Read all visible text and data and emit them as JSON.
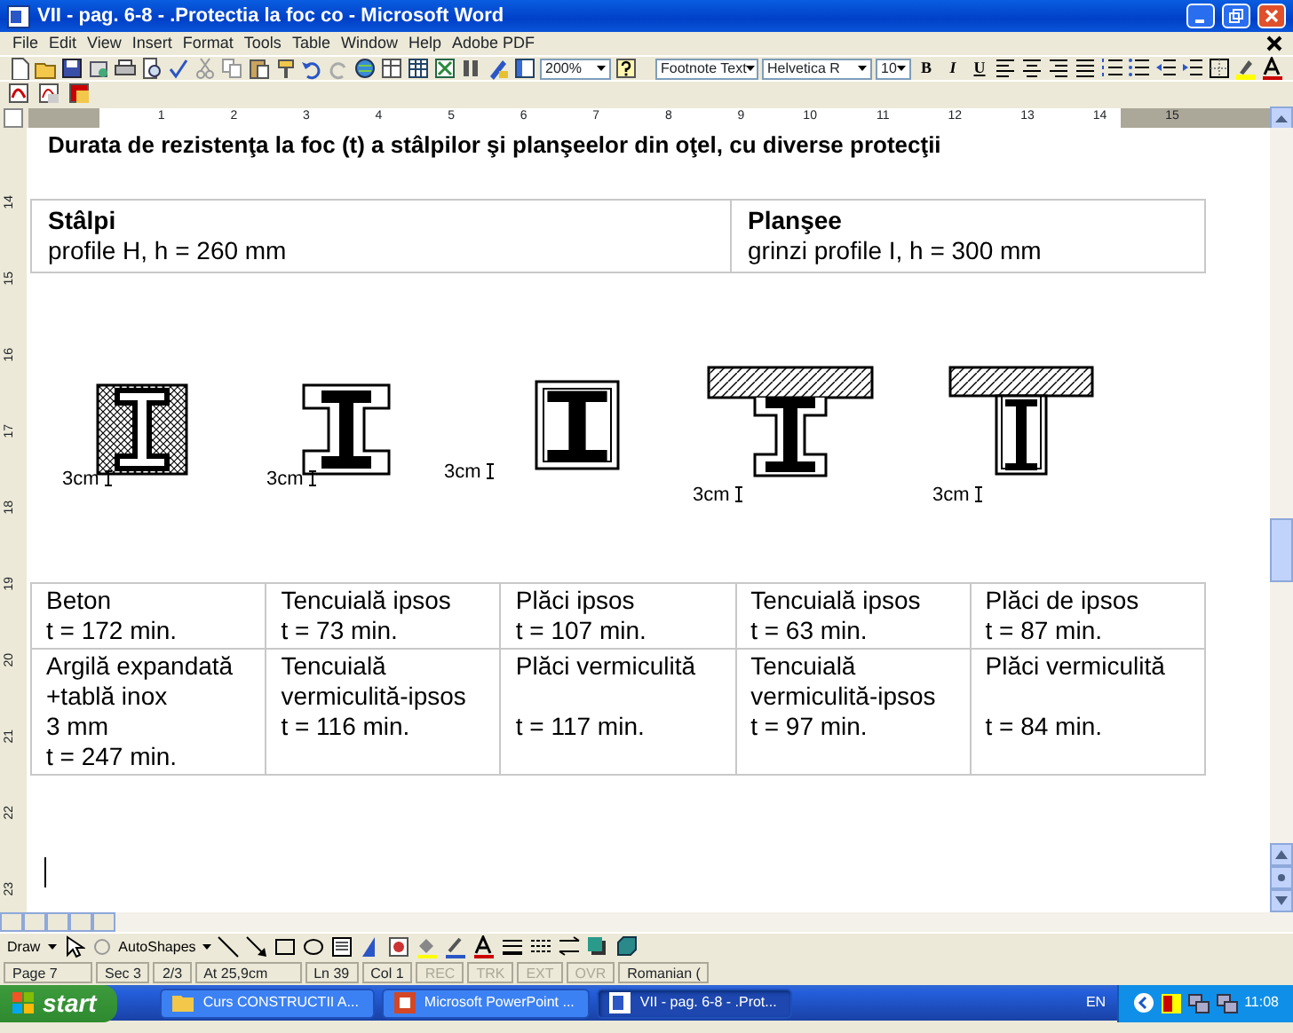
{
  "window": {
    "title": "VII - pag. 6-8 - .Protectia la foc co - Microsoft Word"
  },
  "menu": [
    "File",
    "Edit",
    "View",
    "Insert",
    "Format",
    "Tools",
    "Table",
    "Window",
    "Help",
    "Adobe PDF"
  ],
  "toolbar": {
    "zoom": "200%",
    "style": "Footnote Text",
    "font": "Helvetica R",
    "size": "10",
    "format_buttons": [
      "B",
      "I",
      "U"
    ]
  },
  "ruler": {
    "numbers": [
      "1",
      "2",
      "3",
      "4",
      "5",
      "6",
      "7",
      "8",
      "9",
      "10",
      "11",
      "12",
      "13",
      "14",
      "15"
    ]
  },
  "vertical_ruler": {
    "numbers": [
      "14",
      "15",
      "16",
      "17",
      "18",
      "19",
      "20",
      "21",
      "22",
      "23"
    ]
  },
  "document": {
    "heading": "Durata de rezistenţa la foc (t) a stâlpilor şi planşeelor din oţel, cu diverse protecţii",
    "profile_table": [
      {
        "header": "Stâlpi",
        "text": "profile H, h = 260 mm"
      },
      {
        "header": "Planşee",
        "text": "grinzi profile I, h = 300 mm"
      }
    ],
    "sections": [
      {
        "kind": "encased",
        "label": "3cm"
      },
      {
        "kind": "contour",
        "label": "3cm"
      },
      {
        "kind": "box",
        "label": "3cm"
      },
      {
        "kind": "slab-contour",
        "label": "3cm"
      },
      {
        "kind": "slab-box",
        "label": "3cm"
      }
    ],
    "protection_table": [
      [
        {
          "lines": [
            "Beton"
          ],
          "time": "t = 172 min."
        },
        {
          "lines": [
            "Tencuială ipsos"
          ],
          "time": "t = 73 min."
        },
        {
          "lines": [
            "Plăci ipsos"
          ],
          "time": "t = 107 min."
        },
        {
          "lines": [
            "Tencuială ipsos"
          ],
          "time": "t = 63 min."
        },
        {
          "lines": [
            "Plăci de ipsos"
          ],
          "time": "t = 87 min."
        }
      ],
      [
        {
          "lines": [
            "Argilă expandată",
            "+tablă inox",
            "3 mm"
          ],
          "time": "t = 247 min."
        },
        {
          "lines": [
            "Tencuială",
            "vermiculită-ipsos"
          ],
          "time": "t = 116 min."
        },
        {
          "lines": [
            "Plăci vermiculită"
          ],
          "time": "t = 117 min."
        },
        {
          "lines": [
            "Tencuială",
            "vermiculită-ipsos"
          ],
          "time": "t = 97 min."
        },
        {
          "lines": [
            "Plăci vermiculită"
          ],
          "time": "t = 84 min."
        }
      ]
    ]
  },
  "draw_toolbar": {
    "draw": "Draw",
    "autoshapes": "AutoShapes"
  },
  "status_bar": [
    {
      "text": "Page 7",
      "disabled": false
    },
    {
      "text": "Sec 3",
      "disabled": false
    },
    {
      "text": "2/3",
      "disabled": false
    },
    {
      "text": "At 25,9cm",
      "disabled": false
    },
    {
      "text": "Ln 39",
      "disabled": false
    },
    {
      "text": "Col 1",
      "disabled": false
    },
    {
      "text": "REC",
      "disabled": true
    },
    {
      "text": "TRK",
      "disabled": true
    },
    {
      "text": "EXT",
      "disabled": true
    },
    {
      "text": "OVR",
      "disabled": true
    },
    {
      "text": "Romanian (",
      "disabled": false
    }
  ],
  "taskbar": {
    "start": "start",
    "tasks": [
      {
        "label": "Curs CONSTRUCTII A...",
        "kind": "folder",
        "selected": false
      },
      {
        "label": "Microsoft PowerPoint ...",
        "kind": "powerpoint",
        "selected": false
      },
      {
        "label": "VII - pag. 6-8 - .Prot...",
        "kind": "word",
        "selected": true
      }
    ],
    "language": "EN",
    "clock": "11:08"
  }
}
